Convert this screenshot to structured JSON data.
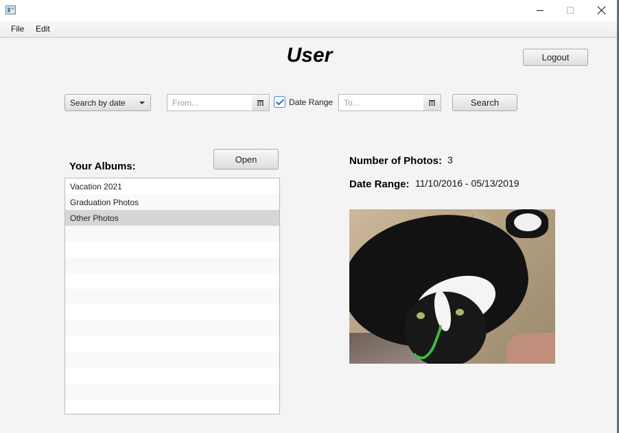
{
  "window": {
    "title": "",
    "controls": [
      "minimize-icon",
      "maximize-icon",
      "close-icon"
    ]
  },
  "menu": {
    "items": [
      {
        "label": "File"
      },
      {
        "label": "Edit"
      }
    ]
  },
  "header": {
    "title": "User",
    "logout_label": "Logout"
  },
  "search": {
    "mode_selected": "Search by date",
    "from_placeholder": "From...",
    "to_placeholder": "To...",
    "date_range_label": "Date Range",
    "date_range_checked": true,
    "search_label": "Search"
  },
  "albums": {
    "label": "Your Albums:",
    "open_label": "Open",
    "items": [
      {
        "name": "Vacation 2021",
        "selected": false
      },
      {
        "name": "Graduation Photos",
        "selected": false
      },
      {
        "name": "Other Photos",
        "selected": true
      }
    ],
    "empty_rows": 12
  },
  "details": {
    "photos_label": "Number of Photos:",
    "photos_value": "3",
    "range_label": "Date Range:",
    "range_value": "11/10/2016 - 05/13/2019"
  },
  "colors": {
    "background": "#f4f4f4",
    "selected_row": "#d6d6d6",
    "checkbox_accent": "#3c8bd4"
  }
}
